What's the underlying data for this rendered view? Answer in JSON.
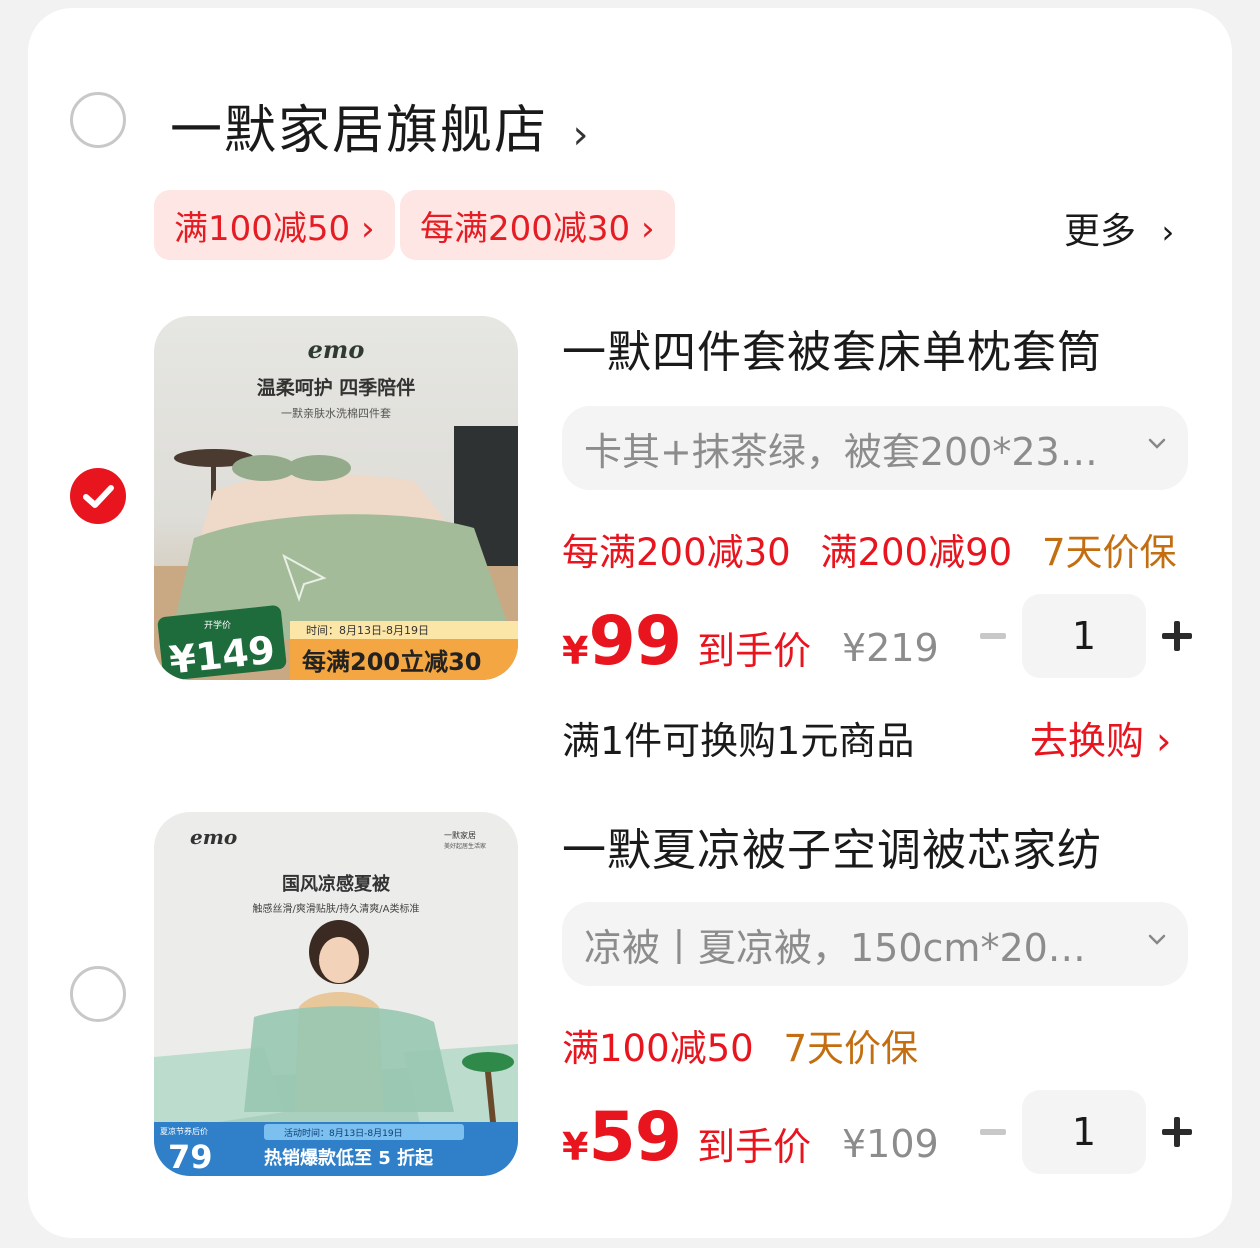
{
  "store": {
    "name": "一默家居旗舰店",
    "chevron": "›",
    "selected": false,
    "coupons": [
      "满100减50 ›",
      "每满200减30 ›"
    ],
    "more_label": "更多",
    "more_chevron": "›"
  },
  "items": [
    {
      "selected": true,
      "title": "一默四件套被套床单枕套筒",
      "sku": "卡其+抹茶绿，被套200*23…",
      "promos": [
        {
          "text": "每满200减30",
          "color": "red"
        },
        {
          "text": "满200减90",
          "color": "red"
        },
        {
          "text": "7天价保",
          "color": "orange"
        }
      ],
      "price_symbol": "¥",
      "price": "99",
      "price_label": "到手价",
      "original_price": "¥219",
      "quantity": "1",
      "exchange_text": "满1件可换购1元商品",
      "exchange_button": "去换购 ›",
      "image": {
        "brand": "emo",
        "headline": "温柔呵护 四季陪伴",
        "subline": "一默亲肤水洗棉四件套",
        "badge_tag": "开学价",
        "badge_price": "¥149",
        "event_time": "时间：8月13日-8月19日",
        "event_text": "每满200立减30"
      }
    },
    {
      "selected": false,
      "title": "一默夏凉被子空调被芯家纺",
      "sku": "凉被丨夏凉被，150cm*20…",
      "promos": [
        {
          "text": "满100减50",
          "color": "red"
        },
        {
          "text": "7天价保",
          "color": "orange"
        }
      ],
      "price_symbol": "¥",
      "price": "59",
      "price_label": "到手价",
      "original_price": "¥109",
      "quantity": "1",
      "image": {
        "brand": "emo",
        "corner_logo": "一默家居",
        "corner_sub": "美好起居生活家",
        "headline": "国风凉感夏被",
        "subline": "触感丝滑/爽滑贴肤/持久清爽/A类标准",
        "badge_tag": "夏凉节券后价",
        "badge_price": "79",
        "event_time": "活动时间：8月13日-8月19日",
        "event_text": "热销爆款低至 5 折起"
      }
    }
  ]
}
